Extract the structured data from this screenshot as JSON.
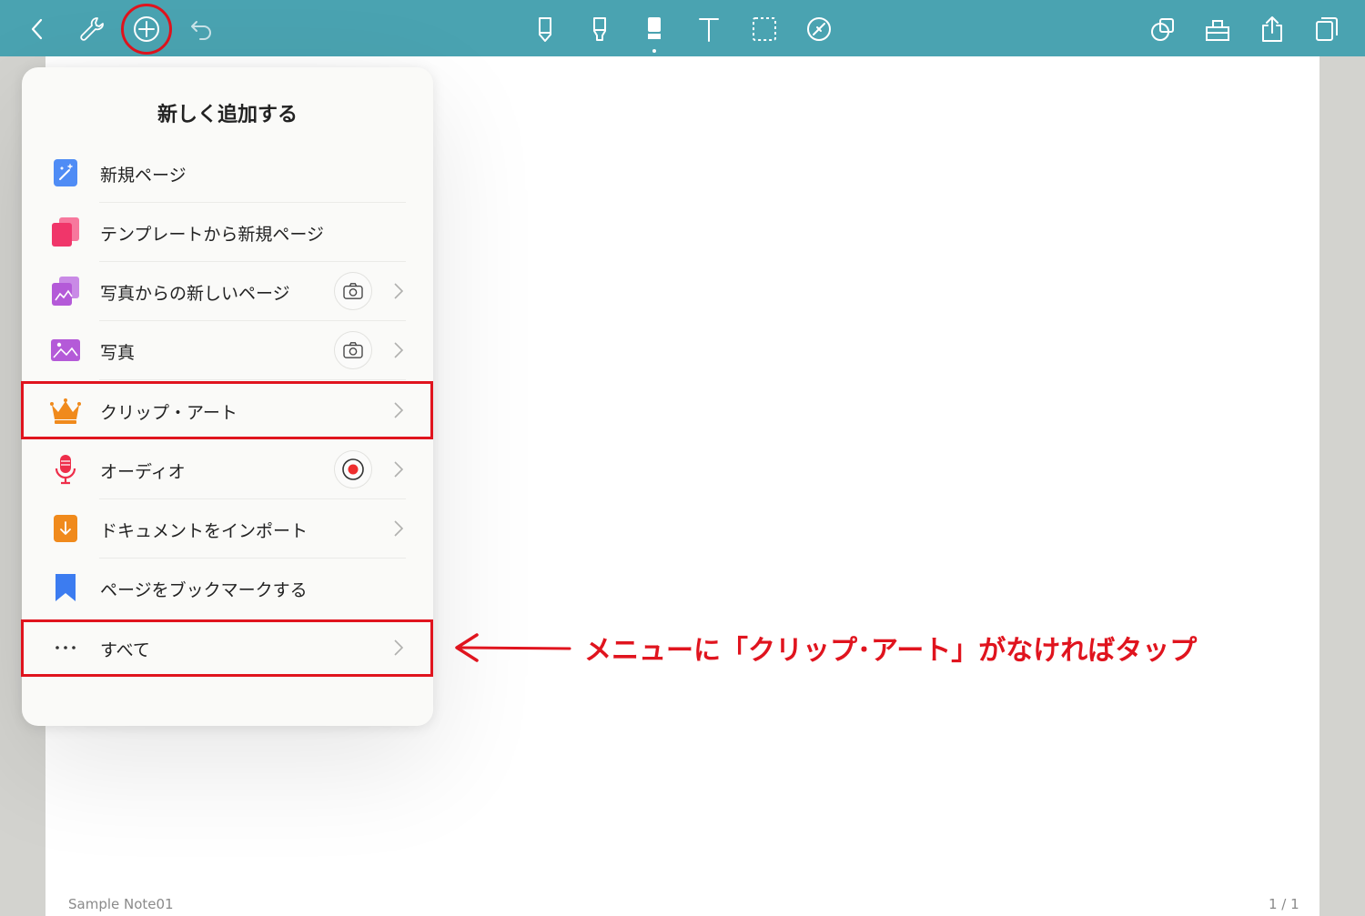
{
  "toolbar": {
    "left_icons": [
      "back-chevron-icon",
      "wrench-icon",
      "plus-icon",
      "undo-icon"
    ],
    "center_icons": [
      "pen-icon",
      "highlighter-icon",
      "eraser-icon",
      "text-icon",
      "lasso-icon",
      "laser-icon"
    ],
    "right_icons": [
      "shapes-icon",
      "tray-icon",
      "share-icon",
      "pages-icon"
    ],
    "color": "#4aa3b1"
  },
  "popover": {
    "title": "新しく追加する",
    "items": [
      {
        "label": "新規ページ",
        "icon": "magic-wand-icon",
        "color": "#4f8cf5"
      },
      {
        "label": "テンプレートから新規ページ",
        "icon": "template-icon",
        "color": "#f0366a"
      },
      {
        "label": "写真からの新しいページ",
        "icon": "photo-page-icon",
        "color": "#b45ad8"
      },
      {
        "label": "写真",
        "icon": "photo-icon",
        "color": "#b45ad8"
      },
      {
        "label": "クリップ・アート",
        "icon": "crown-icon",
        "color": "#f08a1c"
      },
      {
        "label": "オーディオ",
        "icon": "microphone-icon",
        "color": "#ee2e4a"
      },
      {
        "label": "ドキュメントをインポート",
        "icon": "import-icon",
        "color": "#f08a1c"
      },
      {
        "label": "ページをブックマークする",
        "icon": "bookmark-icon",
        "color": "#3c7cf0"
      },
      {
        "label": "すべて",
        "icon": "more-dots-icon",
        "color": "#333333"
      }
    ]
  },
  "annotation": {
    "text": "メニューに「クリップ･アート」がなければタップ",
    "color": "#e0141e"
  },
  "footer": {
    "note_name": "Sample Note01",
    "page_indicator": "1 / 1"
  }
}
